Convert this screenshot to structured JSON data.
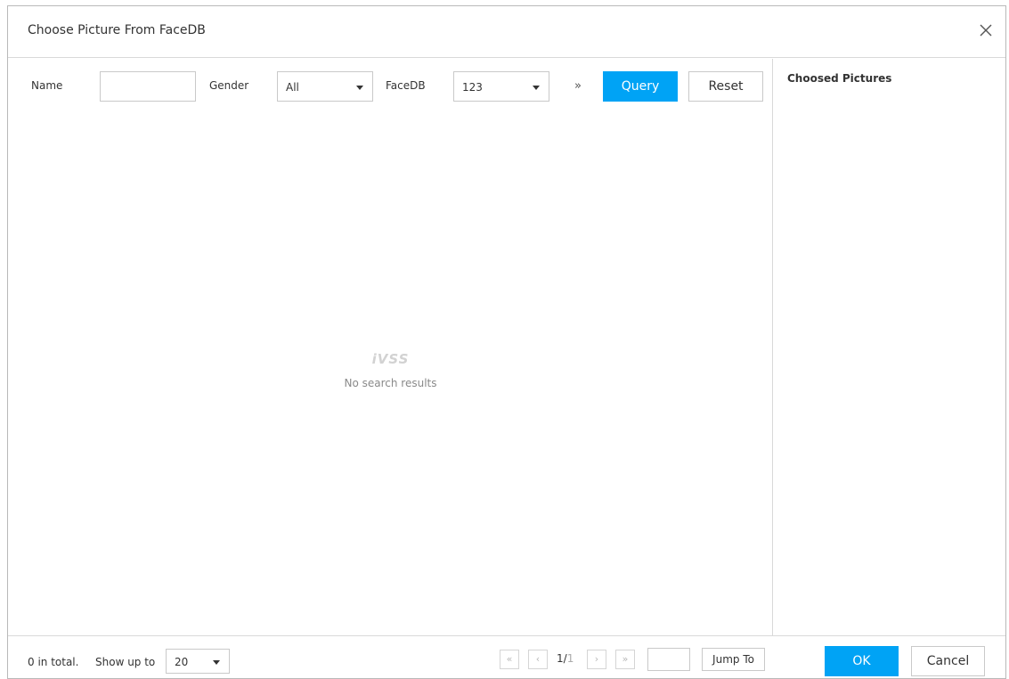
{
  "dialog": {
    "title": "Choose Picture From FaceDB",
    "close_icon": "close-icon"
  },
  "filters": {
    "name_label": "Name",
    "name_value": "",
    "gender_label": "Gender",
    "gender_value": "All",
    "facedb_label": "FaceDB",
    "facedb_value": "123",
    "more_icon": "»",
    "query_label": "Query",
    "reset_label": "Reset"
  },
  "results": {
    "watermark": "iVSS",
    "empty_text": "No search results"
  },
  "chosen": {
    "title": "Choosed Pictures"
  },
  "footer": {
    "total_text": "0 in total.",
    "show_up_to_label": "Show up to",
    "page_size": "20",
    "current_page": "1",
    "total_pages": "1",
    "jump_value": "",
    "jump_label": "Jump To",
    "ok_label": "OK",
    "cancel_label": "Cancel"
  },
  "colors": {
    "accent": "#00a3f5",
    "border": "#d9d9d9"
  }
}
